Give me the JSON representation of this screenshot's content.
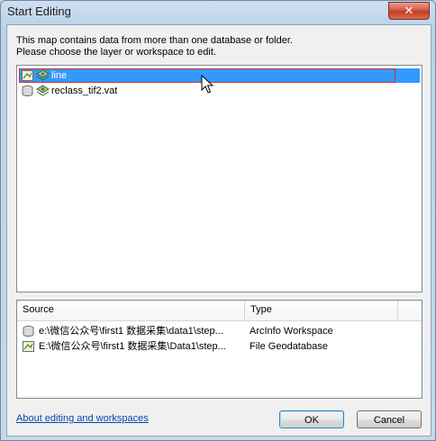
{
  "window": {
    "title": "Start Editing",
    "close_glyph": "✕"
  },
  "instructions": {
    "line1": "This map contains data from more than one database or folder.",
    "line2": "Please choose the layer or workspace to edit."
  },
  "layers": [
    {
      "label": "line",
      "workspace_icon": "arcinfo-workspace-icon",
      "layer_icon": "layer-icon",
      "selected": true
    },
    {
      "label": "reclass_tif2.vat",
      "workspace_icon": "database-icon",
      "layer_icon": "layer-icon",
      "selected": false
    }
  ],
  "workspaces": {
    "headers": {
      "source": "Source",
      "type": "Type"
    },
    "rows": [
      {
        "source": "e:\\微信公众号\\first1 数据采集\\data1\\step...",
        "type": "ArcInfo Workspace",
        "icon": "database-icon"
      },
      {
        "source": "E:\\微信公众号\\first1 数据采集\\Data1\\step...",
        "type": "File Geodatabase",
        "icon": "geodatabase-icon"
      }
    ]
  },
  "footer": {
    "help_link": "About editing and workspaces",
    "ok_label": "OK",
    "cancel_label": "Cancel"
  },
  "colors": {
    "selection": "#3399ff",
    "focus_border": "#d43030",
    "link": "#0645ad"
  }
}
